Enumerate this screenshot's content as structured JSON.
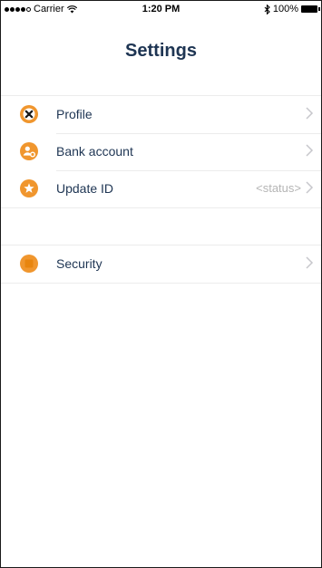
{
  "status_bar": {
    "carrier": "Carrier",
    "time": "1:20 PM",
    "battery": "100%"
  },
  "header": {
    "title": "Settings"
  },
  "settings": {
    "items": [
      {
        "label": "Profile",
        "value": "",
        "icon": "close-x-icon"
      },
      {
        "label": "Bank account",
        "value": "",
        "icon": "user-badge-icon"
      },
      {
        "label": "Update ID",
        "value": "<status>",
        "icon": "star-icon"
      }
    ],
    "security": {
      "label": "Security",
      "value": "",
      "icon": "square-badge-icon"
    }
  },
  "colors": {
    "accent": "#f0962e",
    "title": "#1e3553",
    "chevron": "#c7c7cc"
  }
}
